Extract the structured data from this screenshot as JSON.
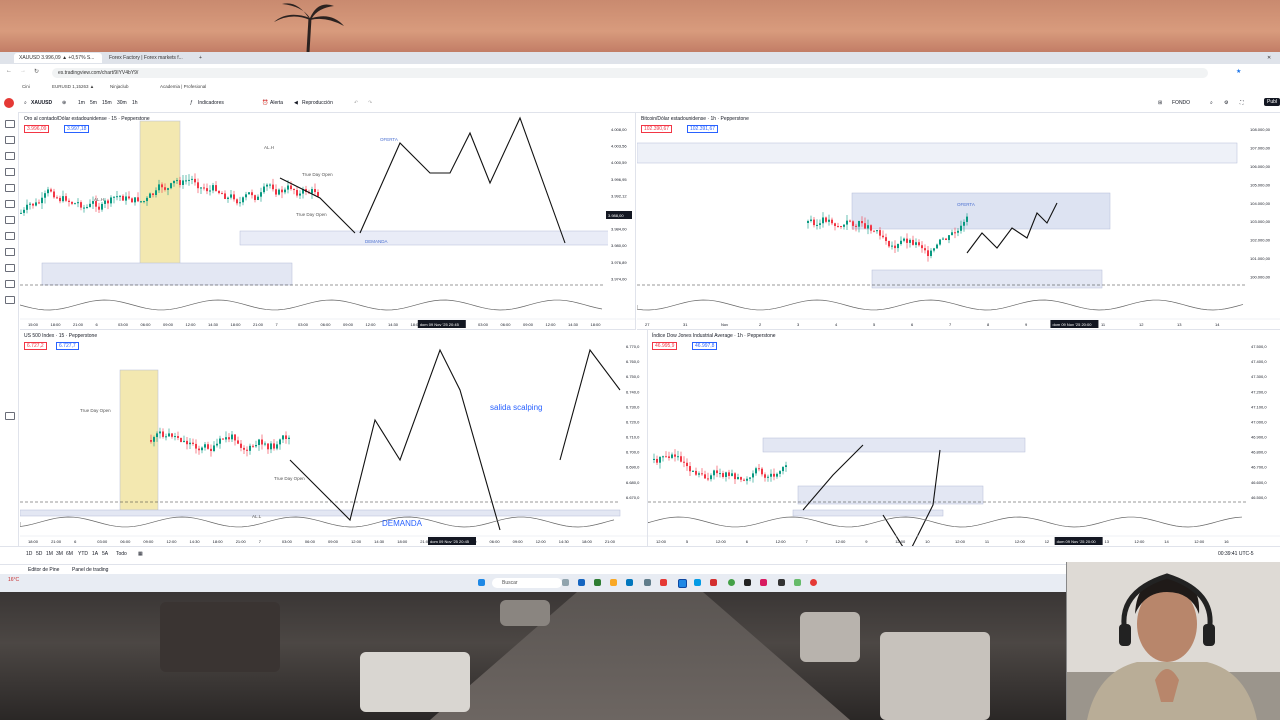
{
  "browser": {
    "tabs": [
      {
        "label": "XAUUSD 3.996,09 ▲ +0,57% S..."
      },
      {
        "label": "Forex Factory | Forex markets f..."
      }
    ],
    "url": "es.tradingview.com/chart/9IYV4bY9/",
    "bookmarks": [
      "Cini",
      "EURUSD 1,15263 ▲",
      "Ninjaclub",
      "Academia | Profesional"
    ]
  },
  "toolbar": {
    "symbol": "XAUUSD",
    "timeframes": [
      "1m",
      "5m",
      "15m",
      "30m",
      "1h"
    ],
    "indicators": "Indicadores",
    "alert": "Alerta",
    "replay": "Reproducción",
    "layout": "FONDO",
    "publish": "Publ"
  },
  "charts": [
    {
      "title": "Oro al contado/Dólar estadounidense · 15 · Pepperstone",
      "sell": "3.996,09",
      "buy": "3.997,18",
      "labels": [
        "OFERTA",
        "DEMANDA",
        "True Day Open",
        "True Day Open",
        "AL.H",
        "AL.H"
      ],
      "price_ticks": [
        "4.008,00",
        "4.003,56",
        "4.000,59",
        "3.996,95",
        "3.992,12",
        "3.988,00",
        "3.984,00",
        "3.980,00",
        "3.976,89",
        "3.974,00"
      ],
      "time_ticks": [
        "15:00",
        "18:00",
        "21:00",
        "6",
        "03:00",
        "06:00",
        "09:00",
        "12:00",
        "14:30",
        "18:00",
        "21:00",
        "7",
        "03:00",
        "06:00",
        "09:00",
        "12:00",
        "14:30",
        "18:00",
        "21:00",
        "9",
        "03:00",
        "06:00",
        "09:00",
        "12:00",
        "14:30",
        "18:00"
      ],
      "cursor_time": "dom 09 Nov '25  20:45",
      "cursor_price": "3.988,00"
    },
    {
      "title": "Bitcoin/Dólar estadounidense · 1h · Pepperstone",
      "sell": "102.390,67",
      "buy": "102.391,67",
      "labels": [
        "OFERTA"
      ],
      "price_ticks": [
        "108.000,00",
        "107.000,00",
        "106.000,00",
        "105.000,00",
        "104.000,00",
        "103.000,00",
        "102.000,00",
        "101.000,00",
        "100.000,00"
      ],
      "time_ticks": [
        "27",
        "31",
        "Nov",
        "2",
        "3",
        "4",
        "5",
        "6",
        "7",
        "8",
        "9",
        "10",
        "11",
        "12",
        "13",
        "14"
      ],
      "cursor_time": "dom 09 Nov '25  20:00"
    },
    {
      "title": "US 500 Index · 15 · Pepperstone",
      "sell": "6.727,2",
      "buy": "6.727,7",
      "labels": [
        "salida scalping",
        "DEMANDA",
        "True Day Open",
        "True Day Open",
        "AL.L"
      ],
      "price_ticks": [
        "6.770,0",
        "6.760,0",
        "6.750,0",
        "6.740,0",
        "6.730,0",
        "6.720,0",
        "6.710,0",
        "6.700,0",
        "6.690,0",
        "6.680,0",
        "6.670,0"
      ],
      "time_ticks": [
        "18:00",
        "21:00",
        "6",
        "03:00",
        "06:00",
        "09:00",
        "12:00",
        "14:30",
        "18:00",
        "21:00",
        "7",
        "03:00",
        "06:00",
        "09:00",
        "12:00",
        "14:30",
        "18:00",
        "21:00",
        "9",
        "03:00",
        "06:00",
        "09:00",
        "12:00",
        "14:30",
        "18:00",
        "21:00"
      ],
      "cursor_time": "dom 09 Nov '25  20:45"
    },
    {
      "title": "Índice Dow Jones Industrial Average · 1h · Pepperstone",
      "sell": "46.995,9",
      "buy": "46.997,8",
      "labels": [],
      "price_ticks": [
        "47.500,0",
        "47.400,0",
        "47.300,0",
        "47.200,0",
        "47.100,0",
        "47.000,0",
        "46.900,0",
        "46.800,0",
        "46.700,0",
        "46.600,0",
        "46.500,0"
      ],
      "time_ticks": [
        "12:00",
        "5",
        "12:00",
        "6",
        "12:00",
        "7",
        "12:00",
        "9",
        "12:00",
        "10",
        "12:00",
        "11",
        "12:00",
        "12",
        "12:00",
        "13",
        "12:00",
        "14",
        "12:00",
        "16"
      ],
      "cursor_time": "dom 09 Nov '25  20:00"
    }
  ],
  "bottom": {
    "ranges": [
      "1D",
      "5D",
      "1M",
      "3M",
      "6M",
      "YTD",
      "1A",
      "5A",
      "Todo"
    ],
    "editor": "Editor de Pine",
    "panel": "Panel de trading",
    "clock": "00:39:41 UTC-5"
  },
  "taskbar": {
    "search": "Buscar",
    "weather": "16°C"
  }
}
